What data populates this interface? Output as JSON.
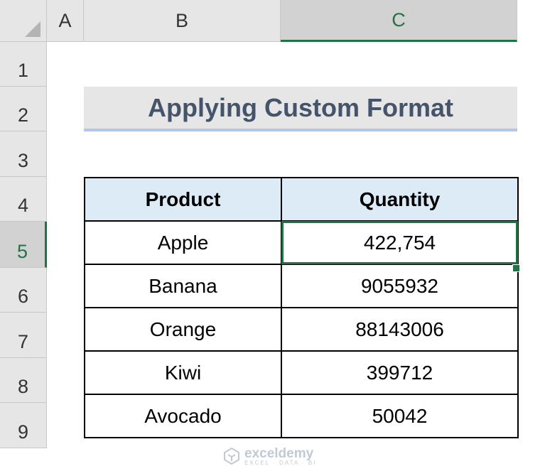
{
  "columns": [
    "A",
    "B",
    "C"
  ],
  "rows": [
    "1",
    "2",
    "3",
    "4",
    "5",
    "6",
    "7",
    "8",
    "9"
  ],
  "selected_column": "C",
  "selected_row": "5",
  "title": "Applying Custom Format",
  "table": {
    "headers": [
      "Product",
      "Quantity"
    ],
    "rows": [
      [
        "Apple",
        "422,754"
      ],
      [
        "Banana",
        "9055932"
      ],
      [
        "Orange",
        "88143006"
      ],
      [
        "Kiwi",
        "399712"
      ],
      [
        "Avocado",
        "50042"
      ]
    ]
  },
  "watermark": {
    "name": "exceldemy",
    "tagline": "EXCEL · DATA · BI"
  },
  "colors": {
    "accent": "#217346",
    "title_text": "#44546a",
    "title_fill": "#e7e6e6",
    "title_underline": "#b4c6e7",
    "header_fill": "#ddebf7"
  }
}
